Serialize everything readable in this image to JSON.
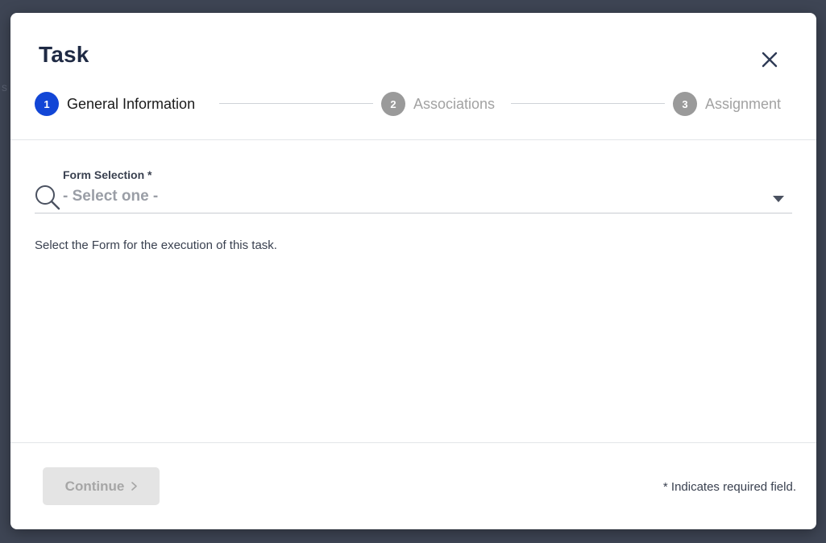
{
  "dialog": {
    "title": "Task",
    "close_icon": "close-icon"
  },
  "stepper": {
    "steps": [
      {
        "number": "1",
        "label": "General Information",
        "state": "active"
      },
      {
        "number": "2",
        "label": "Associations",
        "state": "inactive"
      },
      {
        "number": "3",
        "label": "Assignment",
        "state": "inactive"
      }
    ]
  },
  "form": {
    "field_label": "Form Selection *",
    "select_value": "- Select one -",
    "helper_text": "Select the Form for the execution of this task.",
    "search_icon": "search-icon",
    "dropdown_icon": "caret-down-icon"
  },
  "footer": {
    "continue_label": "Continue",
    "continue_icon": "chevron-right-icon",
    "required_note": "* Indicates required field."
  },
  "colors": {
    "accent": "#1246d6",
    "inactive_step": "#9a9a9a",
    "title": "#1f2a44",
    "overlay": "#3e4554"
  }
}
